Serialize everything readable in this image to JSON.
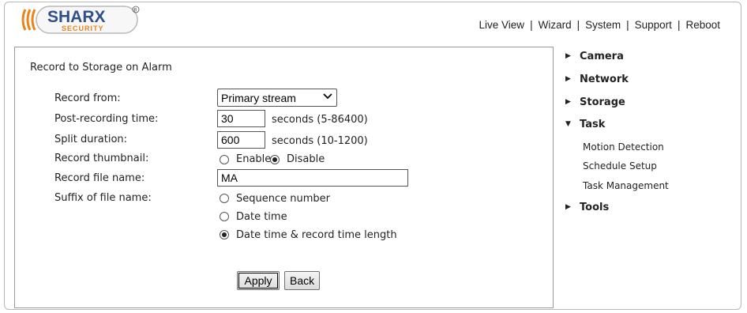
{
  "header": {
    "logo_text": "SHARX",
    "logo_subtext": "SECURITY",
    "nav": [
      "Live View",
      "Wizard",
      "System",
      "Support",
      "Reboot"
    ]
  },
  "form": {
    "title": "Record to Storage on Alarm",
    "record_from": {
      "label": "Record from:",
      "value": "Primary stream"
    },
    "post_recording": {
      "label": "Post-recording time:",
      "value": "30",
      "hint": "seconds (5-86400)"
    },
    "split_duration": {
      "label": "Split duration:",
      "value": "600",
      "hint": "seconds (10-1200)"
    },
    "thumbnail": {
      "label": "Record thumbnail:",
      "enable": "Enable",
      "disable": "Disable",
      "selected": "Disable"
    },
    "file_name": {
      "label": "Record file name:",
      "value": "MA"
    },
    "suffix": {
      "label": "Suffix of file name:",
      "options": [
        "Sequence number",
        "Date time",
        "Date time & record time length"
      ],
      "selected": "Date time & record time length"
    },
    "apply": "Apply",
    "back": "Back"
  },
  "side_menu": {
    "camera": "Camera",
    "network": "Network",
    "storage": "Storage",
    "task": "Task",
    "task_items": [
      "Motion Detection",
      "Schedule Setup",
      "Task Management"
    ],
    "tools": "Tools"
  }
}
